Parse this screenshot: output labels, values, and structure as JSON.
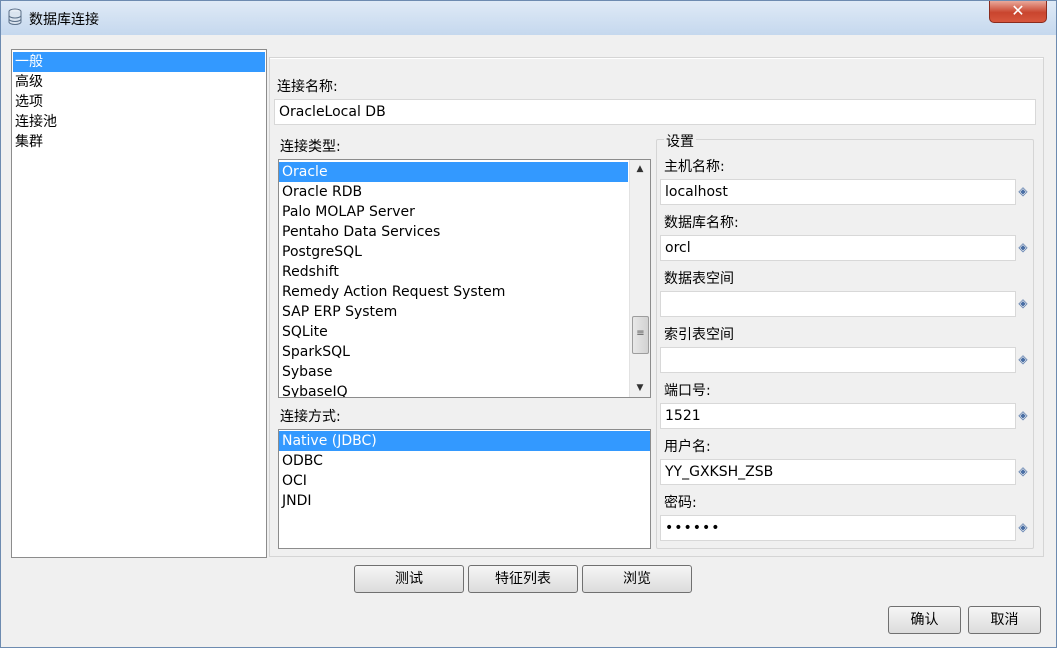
{
  "window": {
    "title": "数据库连接",
    "close_glyph": "✕"
  },
  "nav": {
    "items": [
      "一般",
      "高级",
      "选项",
      "连接池",
      "集群"
    ],
    "selected": 0
  },
  "connection_name": {
    "label": "连接名称:",
    "value": "OracleLocal DB"
  },
  "connection_type": {
    "label": "连接类型:",
    "items": [
      "Oracle",
      "Oracle RDB",
      "Palo MOLAP Server",
      "Pentaho Data Services",
      "PostgreSQL",
      "Redshift",
      "Remedy Action Request System",
      "SAP ERP System",
      "SQLite",
      "SparkSQL",
      "Sybase",
      "SybaseIQ"
    ],
    "selected": 0
  },
  "access_method": {
    "label": "连接方式:",
    "items": [
      "Native (JDBC)",
      "ODBC",
      "OCI",
      "JNDI"
    ],
    "selected": 0
  },
  "settings": {
    "title": "设置",
    "host_label": "主机名称:",
    "host_value": "localhost",
    "db_label": "数据库名称:",
    "db_value": "orcl",
    "data_ts_label": "数据表空间",
    "data_ts_value": "",
    "index_ts_label": "索引表空间",
    "index_ts_value": "",
    "port_label": "端口号:",
    "port_value": "1521",
    "user_label": "用户名:",
    "user_value": "YY_GXKSH_ZSB",
    "password_label": "密码:",
    "password_value": "••••••"
  },
  "buttons": {
    "test": "测试",
    "feature_list": "特征列表",
    "browse": "浏览",
    "ok": "确认",
    "cancel": "取消"
  },
  "icons": {
    "variable_icon": "diamond-variable-icon",
    "accent": "#3399ff"
  }
}
